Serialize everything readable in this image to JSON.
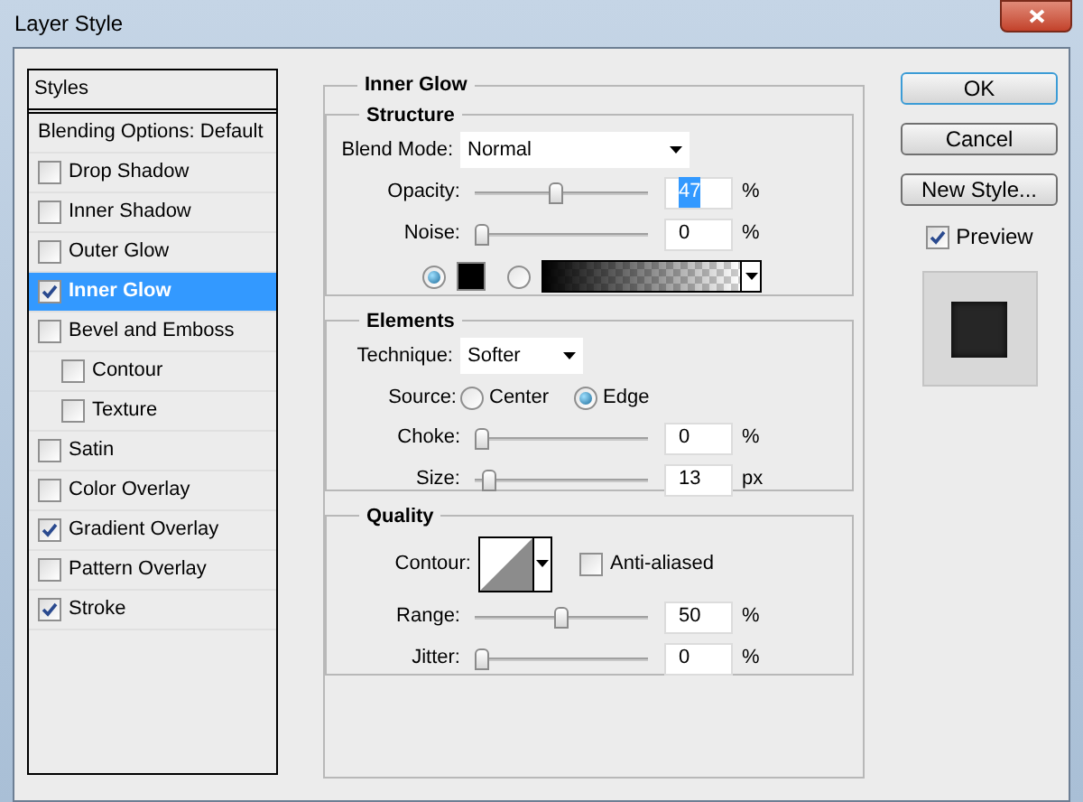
{
  "window": {
    "title": "Layer Style"
  },
  "styles_list": {
    "header": "Styles",
    "items": [
      {
        "label": "Blending Options: Default",
        "kind": "plain",
        "selected": false
      },
      {
        "label": "Drop Shadow",
        "kind": "checkbox",
        "checked": false,
        "selected": false
      },
      {
        "label": "Inner Shadow",
        "kind": "checkbox",
        "checked": false,
        "selected": false
      },
      {
        "label": "Outer Glow",
        "kind": "checkbox",
        "checked": false,
        "selected": false
      },
      {
        "label": "Inner Glow",
        "kind": "checkbox",
        "checked": true,
        "selected": true
      },
      {
        "label": "Bevel and Emboss",
        "kind": "checkbox",
        "checked": false,
        "selected": false,
        "children": [
          {
            "label": "Contour",
            "kind": "checkbox",
            "checked": false,
            "selected": false
          },
          {
            "label": "Texture",
            "kind": "checkbox",
            "checked": false,
            "selected": false
          }
        ]
      },
      {
        "label": "Satin",
        "kind": "checkbox",
        "checked": false,
        "selected": false
      },
      {
        "label": "Color Overlay",
        "kind": "checkbox",
        "checked": false,
        "selected": false
      },
      {
        "label": "Gradient Overlay",
        "kind": "checkbox",
        "checked": true,
        "selected": false
      },
      {
        "label": "Pattern Overlay",
        "kind": "checkbox",
        "checked": false,
        "selected": false
      },
      {
        "label": "Stroke",
        "kind": "checkbox",
        "checked": true,
        "selected": false
      }
    ]
  },
  "inner_glow": {
    "title": "Inner Glow",
    "structure": {
      "title": "Structure",
      "blend_mode": {
        "label": "Blend Mode:",
        "value": "Normal"
      },
      "sliders": [
        {
          "label": "Opacity:",
          "value": "47",
          "unit": "%",
          "level": 0.47,
          "text_selected": true
        },
        {
          "label": "Noise:",
          "value": "0",
          "unit": "%",
          "level": 0,
          "text_selected": false
        }
      ],
      "fill_options": [
        {
          "kind": "color",
          "selected": true
        },
        {
          "kind": "gradient",
          "selected": false
        }
      ]
    },
    "elements": {
      "title": "Elements",
      "technique": {
        "label": "Technique:",
        "value": "Softer"
      },
      "source": {
        "label": "Source:",
        "options": [
          {
            "label": "Center",
            "selected": false
          },
          {
            "label": "Edge",
            "selected": true
          }
        ]
      },
      "sliders": [
        {
          "label": "Choke:",
          "value": "0",
          "unit": "%",
          "level": 0,
          "text_selected": false
        },
        {
          "label": "Size:",
          "value": "13",
          "unit": "px",
          "level": 0.05,
          "text_selected": false
        }
      ]
    },
    "quality": {
      "title": "Quality",
      "contour": {
        "label": "Contour:"
      },
      "anti_aliased": {
        "label": "Anti-aliased",
        "checked": false
      },
      "sliders": [
        {
          "label": "Range:",
          "value": "50",
          "unit": "%",
          "level": 0.5,
          "text_selected": false
        },
        {
          "label": "Jitter:",
          "value": "0",
          "unit": "%",
          "level": 0,
          "text_selected": false
        }
      ]
    }
  },
  "buttons": [
    {
      "label": "OK",
      "default": true
    },
    {
      "label": "Cancel",
      "default": false
    },
    {
      "label": "New Style...",
      "default": false
    }
  ],
  "preview": {
    "label": "Preview",
    "checked": true
  }
}
